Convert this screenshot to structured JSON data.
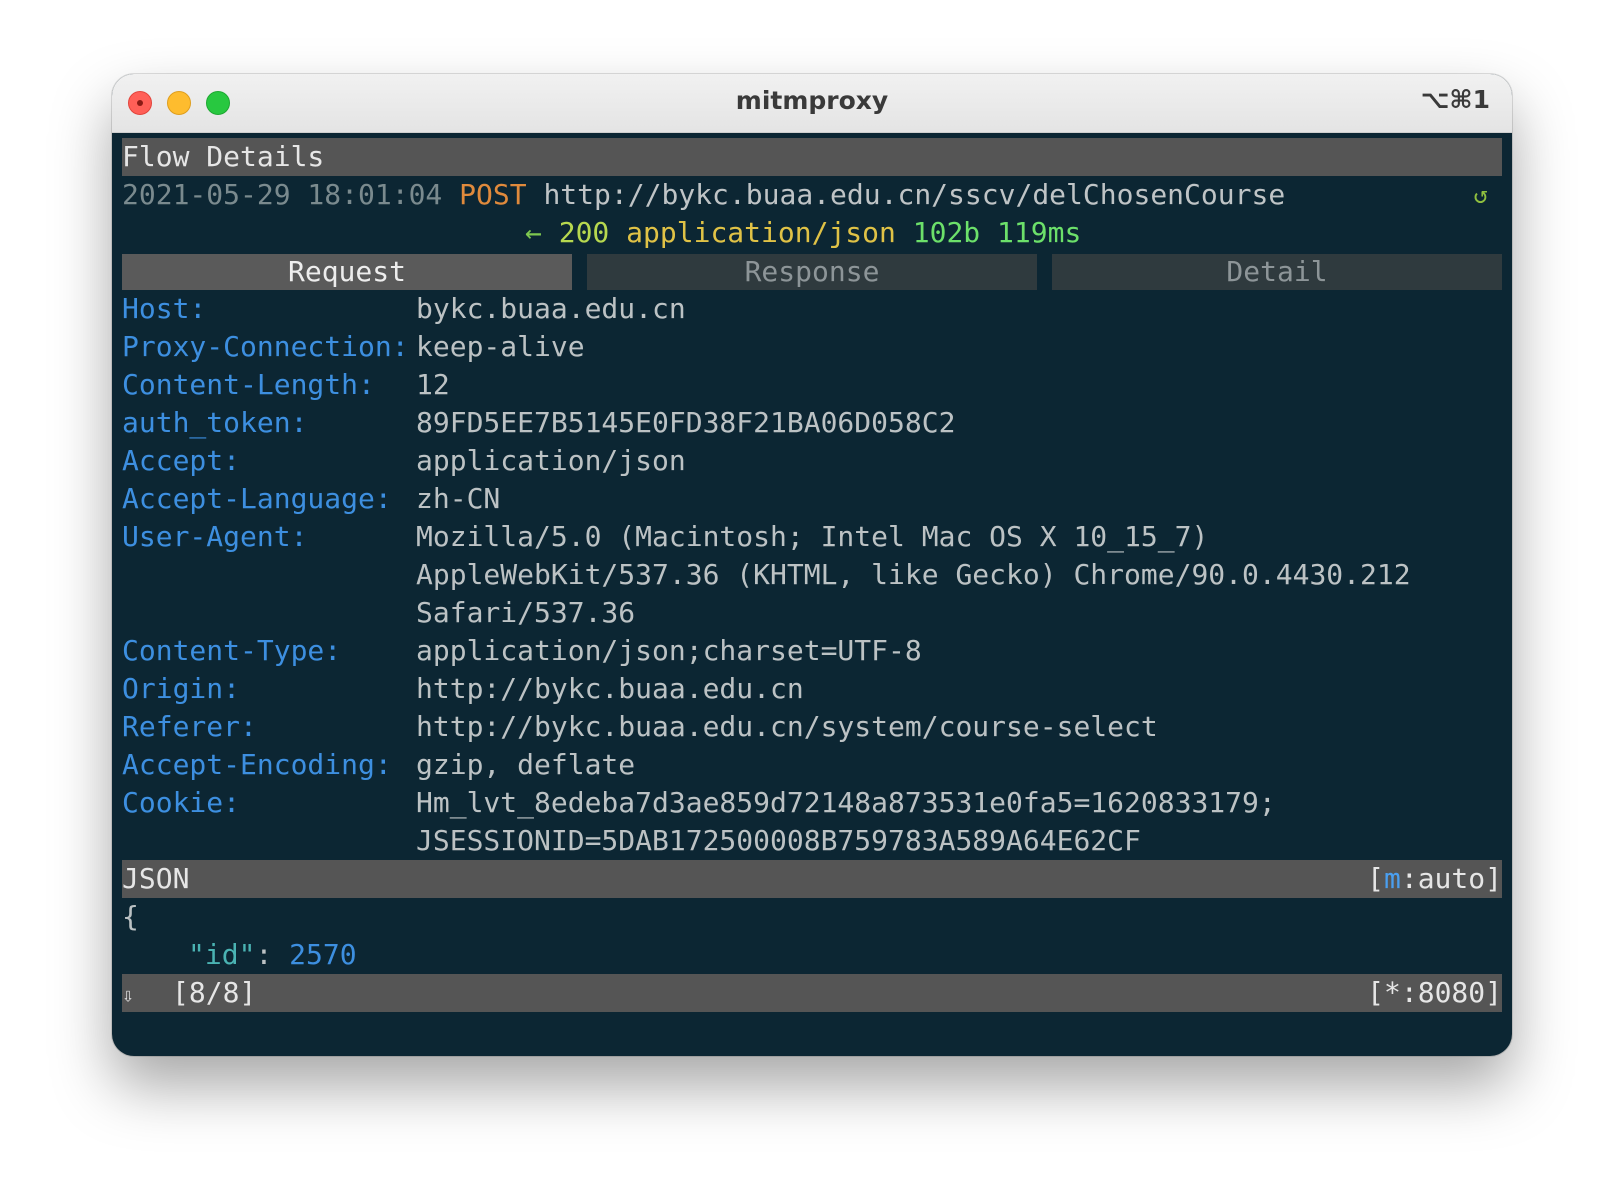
{
  "window": {
    "title": "mitmproxy",
    "shortcut": "⌥⌘1"
  },
  "header": {
    "title": "Flow Details"
  },
  "flow": {
    "timestamp": "2021-05-29 18:01:04",
    "method": "POST",
    "url": "http://bykc.buaa.edu.cn/sscv/delChosenCourse",
    "replay_icon": "↺",
    "response_arrow": "←",
    "status_code": "200",
    "content_type": "application/json",
    "size": "102b",
    "duration": "119ms"
  },
  "tabs": [
    {
      "label": "Request",
      "active": true
    },
    {
      "label": "Response",
      "active": false
    },
    {
      "label": "Detail",
      "active": false
    }
  ],
  "headers": [
    {
      "name": "Host:",
      "lines": [
        "bykc.buaa.edu.cn"
      ]
    },
    {
      "name": "Proxy-Connection:",
      "lines": [
        "keep-alive"
      ]
    },
    {
      "name": "Content-Length:",
      "lines": [
        "12"
      ]
    },
    {
      "name": "auth_token:",
      "lines": [
        "89FD5EE7B5145E0FD38F21BA06D058C2"
      ]
    },
    {
      "name": "Accept:",
      "lines": [
        "application/json"
      ]
    },
    {
      "name": "Accept-Language:",
      "lines": [
        "zh-CN"
      ]
    },
    {
      "name": "User-Agent:",
      "lines": [
        "Mozilla/5.0 (Macintosh; Intel Mac OS X 10_15_7)",
        "AppleWebKit/537.36 (KHTML, like Gecko) Chrome/90.0.4430.212",
        "Safari/537.36"
      ]
    },
    {
      "name": "Content-Type:",
      "lines": [
        "application/json;charset=UTF-8"
      ]
    },
    {
      "name": "Origin:",
      "lines": [
        "http://bykc.buaa.edu.cn"
      ]
    },
    {
      "name": "Referer:",
      "lines": [
        "http://bykc.buaa.edu.cn/system/course-select"
      ]
    },
    {
      "name": "Accept-Encoding:",
      "lines": [
        "gzip, deflate"
      ]
    },
    {
      "name": "Cookie:",
      "lines": [
        "Hm_lvt_8edeba7d3ae859d72148a873531e0fa5=1620833179;",
        "JSESSIONID=5DAB172500008B759783A589A64E62CF"
      ]
    }
  ],
  "body_view": {
    "label": "JSON",
    "mode_open": "[",
    "mode_key": "m",
    "mode_rest": ":auto]",
    "open_brace": "{",
    "key": "\"id\"",
    "sep": ": ",
    "value": "2570"
  },
  "statusbar": {
    "scroll_icon": "⇩",
    "position": "[8/8]",
    "listen": "[*:8080]"
  }
}
